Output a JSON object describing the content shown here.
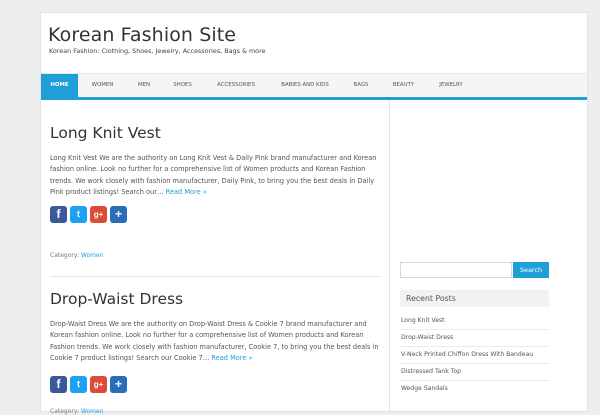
{
  "site": {
    "title": "Korean Fashion Site",
    "description": "Korean Fashion: Clothing, Shoes, Jewelry, Accessories, Bags & more"
  },
  "nav": {
    "items": [
      "HOME",
      "WOMEN",
      "MEN",
      "SHOES",
      "ACCESSORIES",
      "BABIES AND KIDS",
      "BAGS",
      "BEAUTY",
      "JEWELRY"
    ],
    "active_index": 0
  },
  "posts": [
    {
      "title": "Long Knit Vest",
      "excerpt": "Long Knit Vest We are the authority on Long Knit Vest & Daily Pink brand manufacturer and Korean fashion online. Look no further for a comprehensive list of Women products and Korean Fashion trends. We work closely with fashion manufacturer, Daily Pink, to bring you the best deals in Daily Pink product listings! Search our…",
      "read_more": "Read More »",
      "category_label": "Category:",
      "category": "Women"
    },
    {
      "title": "Drop-Waist Dress",
      "excerpt": "Drop-Waist Dress We are the authority on Drop-Waist Dress & Cookie 7 brand manufacturer and Korean fashion online. Look no further for a comprehensive list of Women products and Korean Fashion trends. We work closely with fashion manufacturer, Cookie 7, to bring you the best deals in Cookie 7 product listings! Search our Cookie 7…",
      "read_more": "Read More »",
      "category_label": "Category:",
      "category": "Women"
    }
  ],
  "share_icons": [
    "facebook-icon",
    "twitter-icon",
    "google-plus-icon",
    "share-icon"
  ],
  "share_glyphs": {
    "facebook": "f",
    "twitter": "t",
    "google_plus": "g+",
    "share": "+"
  },
  "sidebar": {
    "search_button": "Search",
    "search_value": "",
    "recent_title": "Recent Posts",
    "recent_posts": [
      "Long Knit Vest",
      "Drop-Waist Dress",
      "V-Neck Printed Chiffon Dress With Bandeau",
      "Distressed Tank Top",
      "Wedge Sandals"
    ]
  },
  "colors": {
    "accent": "#1e9fd7",
    "facebook": "#3b5998",
    "twitter": "#1da1f2",
    "google_plus": "#dd4b39",
    "share": "#2a6ebb"
  }
}
